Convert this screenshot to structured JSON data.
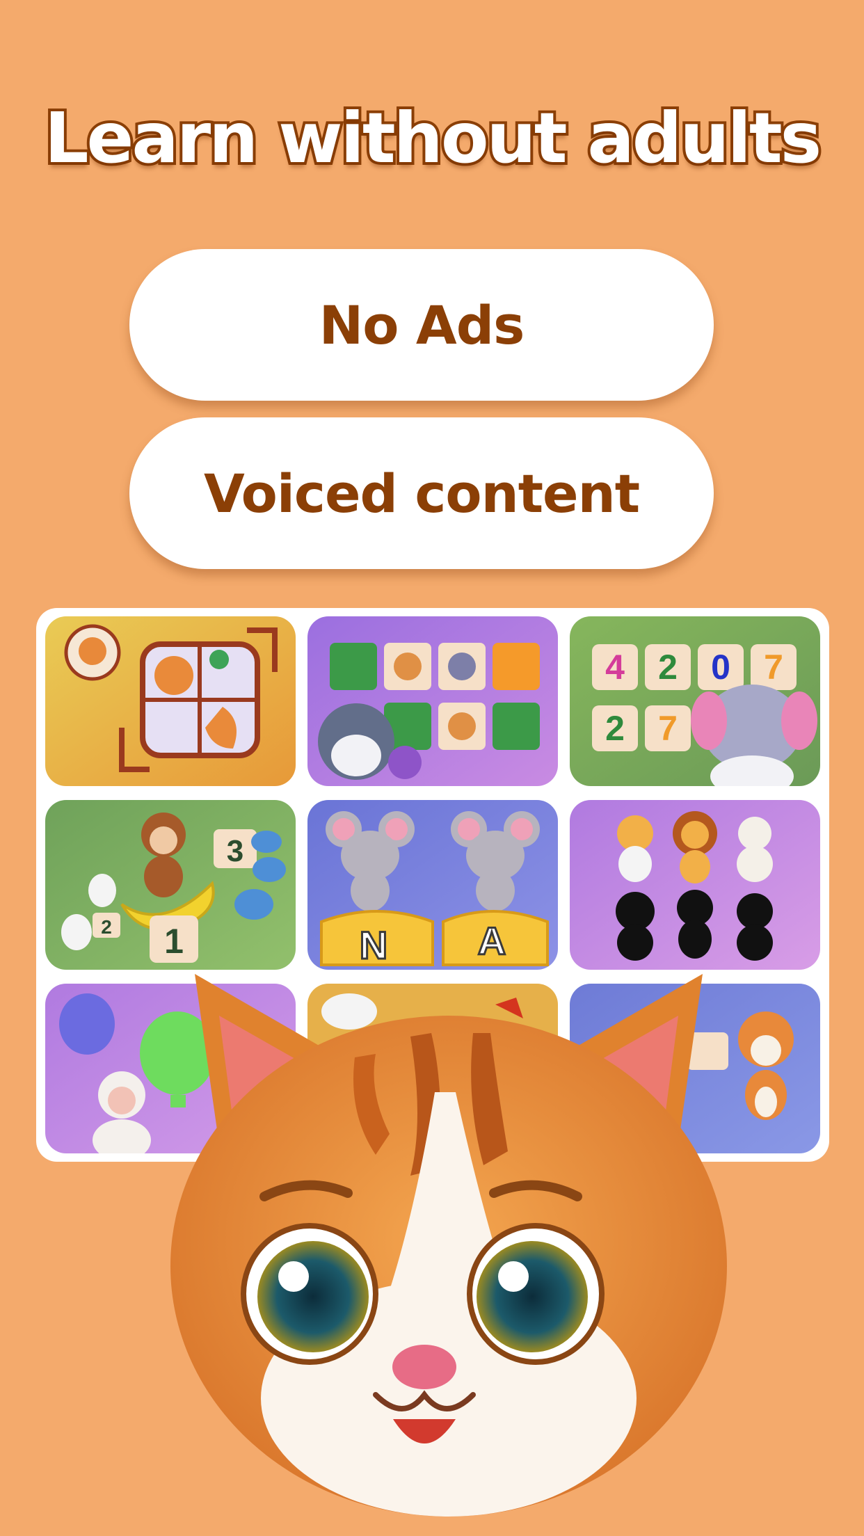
{
  "headline": "Learn without adults",
  "features": [
    {
      "label": "No Ads"
    },
    {
      "label": "Voiced content"
    }
  ],
  "tiles": [
    {
      "name": "puzzle-game-tile",
      "bg": [
        "#E7C24E",
        "#E89A3A"
      ],
      "numbers": []
    },
    {
      "name": "memory-cards-tile",
      "bg": [
        "#9D72E0",
        "#C98AE3"
      ],
      "numbers": []
    },
    {
      "name": "counting-numbers-tile",
      "bg": [
        "#7FB05A",
        "#6E9A55"
      ],
      "numbers": [
        "4",
        "2",
        "0",
        "7",
        "2",
        "7"
      ]
    },
    {
      "name": "monkey-counting-tile",
      "bg": [
        "#6FA05A",
        "#8EBF6A"
      ],
      "numbers": [
        "3",
        "2",
        "1"
      ]
    },
    {
      "name": "mouse-letters-tile",
      "bg": [
        "#6E78D8",
        "#8B8FE6"
      ],
      "numbers": [
        "N",
        "A"
      ]
    },
    {
      "name": "shadow-match-tile",
      "bg": [
        "#B47BE0",
        "#D69CE6"
      ],
      "numbers": []
    },
    {
      "name": "balloon-colors-tile",
      "bg": [
        "#B47BE0",
        "#D29BE8"
      ],
      "numbers": []
    },
    {
      "name": "llama-game-tile",
      "bg": [
        "#E8B84C",
        "#E2A23D"
      ],
      "numbers": []
    },
    {
      "name": "tiger-game-tile",
      "bg": [
        "#6E7BD6",
        "#8A98E6"
      ],
      "numbers": []
    }
  ],
  "colors": {
    "background": "#F4AA6C",
    "accent_brown": "#8B3F06",
    "pill_bg": "#FFFFFF"
  }
}
